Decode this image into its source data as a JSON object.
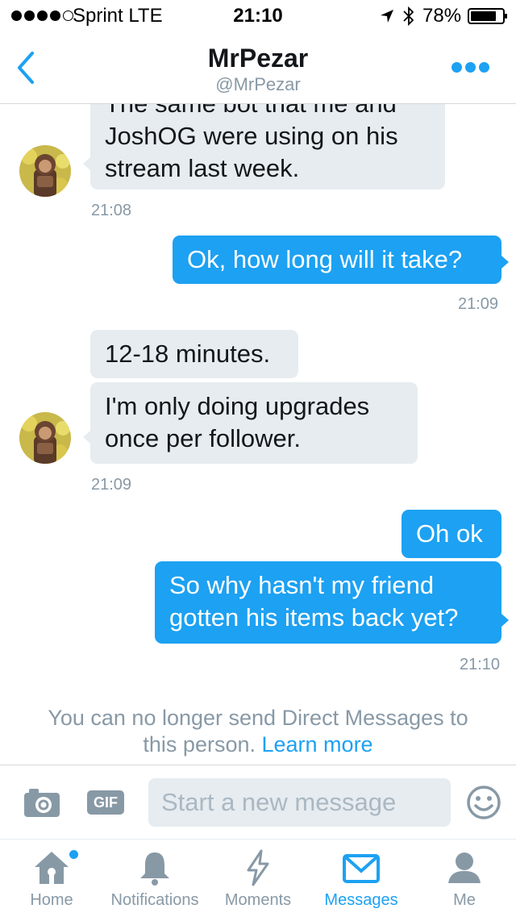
{
  "status_bar": {
    "carrier": "Sprint  LTE",
    "time": "21:10",
    "battery": "78%",
    "signal_bars_filled": 4,
    "signal_bars_total": 5
  },
  "header": {
    "title": "MrPezar",
    "handle": "@MrPezar",
    "back_icon": "chevron-left-icon",
    "more_icon": "more-dots-icon"
  },
  "messages": [
    {
      "direction": "incoming",
      "lines": [
        "The same bot that me and",
        "JoshOG were using on his",
        "stream last week."
      ]
    },
    {
      "direction": "incoming-time",
      "text": "21:08"
    },
    {
      "direction": "outgoing",
      "lines": [
        "Ok, how long will it take?"
      ]
    },
    {
      "direction": "outgoing-time",
      "text": "21:09"
    },
    {
      "direction": "incoming",
      "lines": [
        "12-18 minutes."
      ]
    },
    {
      "direction": "incoming",
      "lines": [
        "I'm only doing upgrades",
        "once per follower."
      ]
    },
    {
      "direction": "incoming-time",
      "text": "21:09"
    },
    {
      "direction": "outgoing",
      "lines": [
        "Oh ok"
      ]
    },
    {
      "direction": "outgoing",
      "lines": [
        "So why hasn't my friend",
        "gotten his items back yet?"
      ]
    },
    {
      "direction": "outgoing-time",
      "text": "21:10"
    }
  ],
  "notice": {
    "line1": "You can no longer send Direct Messages to",
    "line2": "this person.",
    "link": "Learn more"
  },
  "composer": {
    "placeholder": "Start a new message",
    "gif_label": "GIF",
    "camera_icon": "camera-icon",
    "emoji_icon": "emoji-icon"
  },
  "tabs": [
    {
      "label": "Home",
      "icon": "home-icon",
      "active": false,
      "has_dot": true
    },
    {
      "label": "Notifications",
      "icon": "bell-icon",
      "active": false,
      "has_dot": false
    },
    {
      "label": "Moments",
      "icon": "lightning-icon",
      "active": false,
      "has_dot": false
    },
    {
      "label": "Messages",
      "icon": "envelope-icon",
      "active": true,
      "has_dot": false
    },
    {
      "label": "Me",
      "icon": "person-icon",
      "active": false,
      "has_dot": false
    }
  ],
  "colors": {
    "accent": "#1da1f2",
    "incoming_bubble": "#e6ecf0",
    "muted_text": "#8899a6"
  }
}
